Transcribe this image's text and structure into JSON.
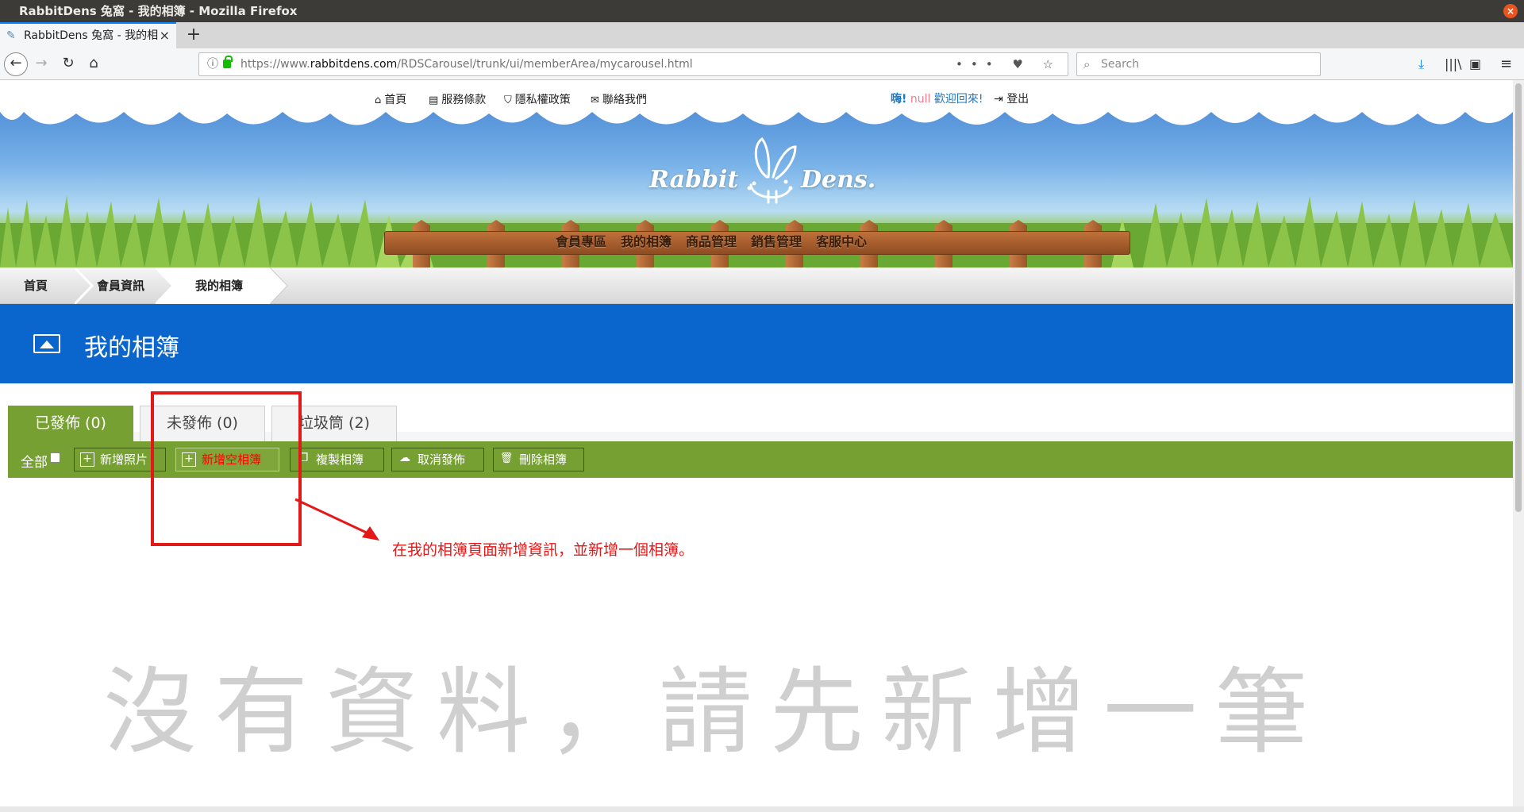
{
  "window": {
    "title": "RabbitDens 兔窩 - 我的相簿 - Mozilla Firefox",
    "close_glyph": "×"
  },
  "browser": {
    "tab_title": "RabbitDens 兔窩 - 我的相",
    "tab_close": "×",
    "new_tab": "+",
    "url_prefix": "https://www.",
    "url_domain": "rabbitdens.com",
    "url_path": "/RDSCarousel/trunk/ui/memberArea/mycarousel.html",
    "search_placeholder": "Search",
    "url_actions": "••• ♥ ☆",
    "icons": {
      "back": "←",
      "forward": "→",
      "reload": "↻",
      "home": "⌂",
      "download": "⤓",
      "library": "|||\\",
      "sidebar": "▣",
      "menu": "≡"
    }
  },
  "site": {
    "top_links": [
      {
        "icon": "⌂",
        "label": "首頁"
      },
      {
        "icon": "▤",
        "label": "服務條款"
      },
      {
        "icon": "⛉",
        "label": "隱私權政策"
      },
      {
        "icon": "✉",
        "label": "聯絡我們"
      }
    ],
    "greeting": {
      "hi": "嗨!",
      "user": "null",
      "welcome": "歡迎回來!"
    },
    "logout": {
      "icon": "⇥",
      "label": "登出"
    },
    "logo_left": "Rabbit",
    "logo_right": "Dens.",
    "main_menu": [
      "會員專區",
      "我的相簿",
      "商品管理",
      "銷售管理",
      "客服中心"
    ]
  },
  "breadcrumb": [
    "首頁",
    "會員資訊",
    "我的相簿"
  ],
  "page_title": "我的相簿",
  "tabs": [
    {
      "label": "已發佈 (0)"
    },
    {
      "label": "未發佈 (0)"
    },
    {
      "label": "垃圾筒 (2)"
    }
  ],
  "toolbar": {
    "select_all": "全部",
    "buttons": [
      {
        "icon": "+",
        "label": "新增照片"
      },
      {
        "icon": "+",
        "label": "新增空相簿"
      },
      {
        "icon": "❐",
        "label": "複製相簿"
      },
      {
        "icon": "☁",
        "label": "取消發佈"
      },
      {
        "icon": "🗑",
        "label": "刪除相簿"
      }
    ]
  },
  "empty_message": "沒有資料，請先新增一筆",
  "annotation": {
    "text": "在我的相簿頁面新增資訊，並新增一個相簿。",
    "color": "#e31818"
  },
  "colors": {
    "banner_blue": "#0a66cc",
    "toolbar_green": "#76a032",
    "highlight_red": "#ff0000"
  }
}
